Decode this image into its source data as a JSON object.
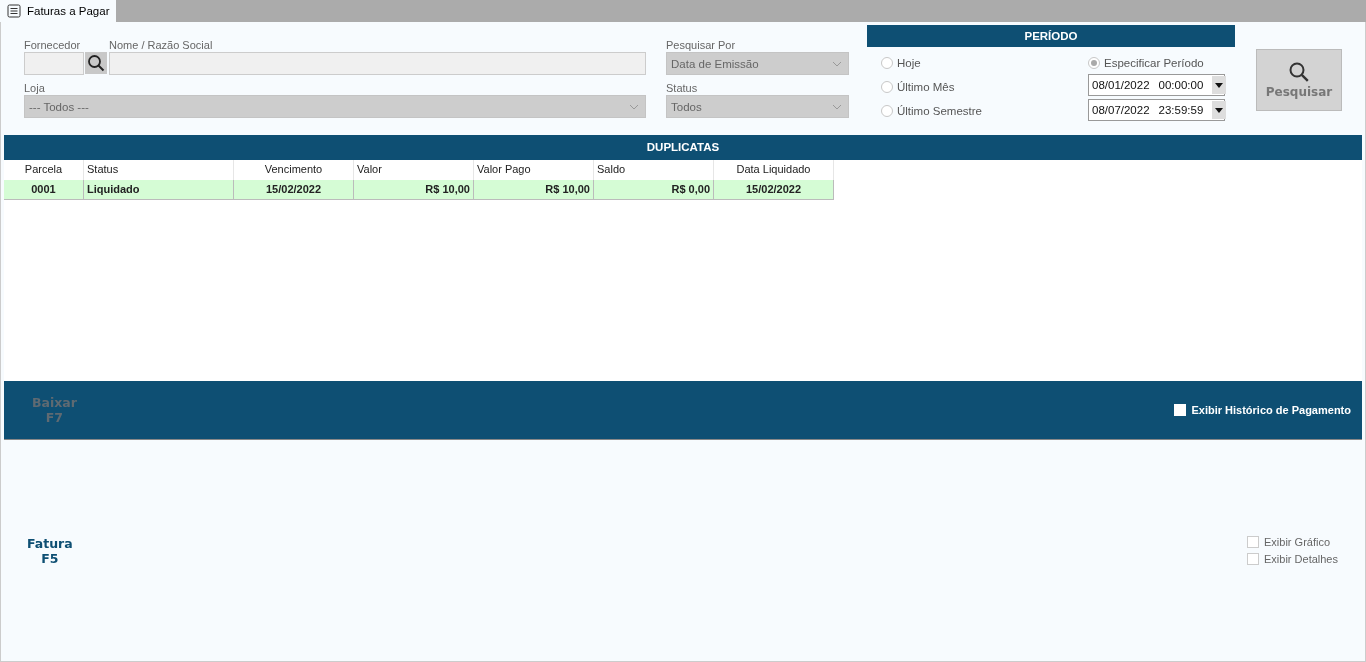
{
  "tab": {
    "label": "Faturas a Pagar",
    "selected": true
  },
  "filters": {
    "fornecedor": {
      "label": "Fornecedor"
    },
    "nome": {
      "label": "Nome / Razão Social"
    },
    "loja": {
      "label": "Loja",
      "value": "--- Todos ---"
    },
    "pesquisar_por": {
      "label": "Pesquisar Por",
      "value": "Data de Emissão"
    },
    "status": {
      "label": "Status",
      "value": "Todos"
    }
  },
  "periodo": {
    "title": "PERÍODO",
    "options": [
      {
        "label": "Hoje",
        "selected": false
      },
      {
        "label": "Último Mês",
        "selected": false
      },
      {
        "label": "Último Semestre",
        "selected": false
      }
    ],
    "custom": {
      "label": "Especificar Período",
      "selected": true
    },
    "dates": [
      {
        "date": "08/01/2022",
        "time": "00:00:00"
      },
      {
        "date": "08/07/2022",
        "time": "23:59:59"
      }
    ]
  },
  "search_button": {
    "label": "Pesquisar",
    "disabled": true
  },
  "table": {
    "title": "DUPLICATAS",
    "columns": [
      "Parcela",
      "Status",
      "Vencimento",
      "Valor",
      "Valor Pago",
      "Saldo",
      "Data Liquidado"
    ],
    "rows": [
      {
        "cells": [
          "0001",
          "Liquidado",
          "15/02/2022",
          "R$ 10,00",
          "R$ 10,00",
          "R$ 0,00",
          "15/02/2022"
        ],
        "selected": true
      }
    ]
  },
  "action_bar": {
    "buttons": [
      {
        "label": "Baixar",
        "key": "F7",
        "disabled": true
      }
    ],
    "checkbox": {
      "label": "Exibir Histórico de Pagamento",
      "checked": false
    }
  },
  "bottom": {
    "buttons": [
      {
        "label": "Fatura",
        "key": "F5",
        "disabled": false
      }
    ],
    "checkboxes": [
      {
        "label": "Exibir Gráfico",
        "checked": false,
        "disabled": true
      },
      {
        "label": "Exibir Detalhes",
        "checked": false,
        "disabled": true
      }
    ]
  }
}
